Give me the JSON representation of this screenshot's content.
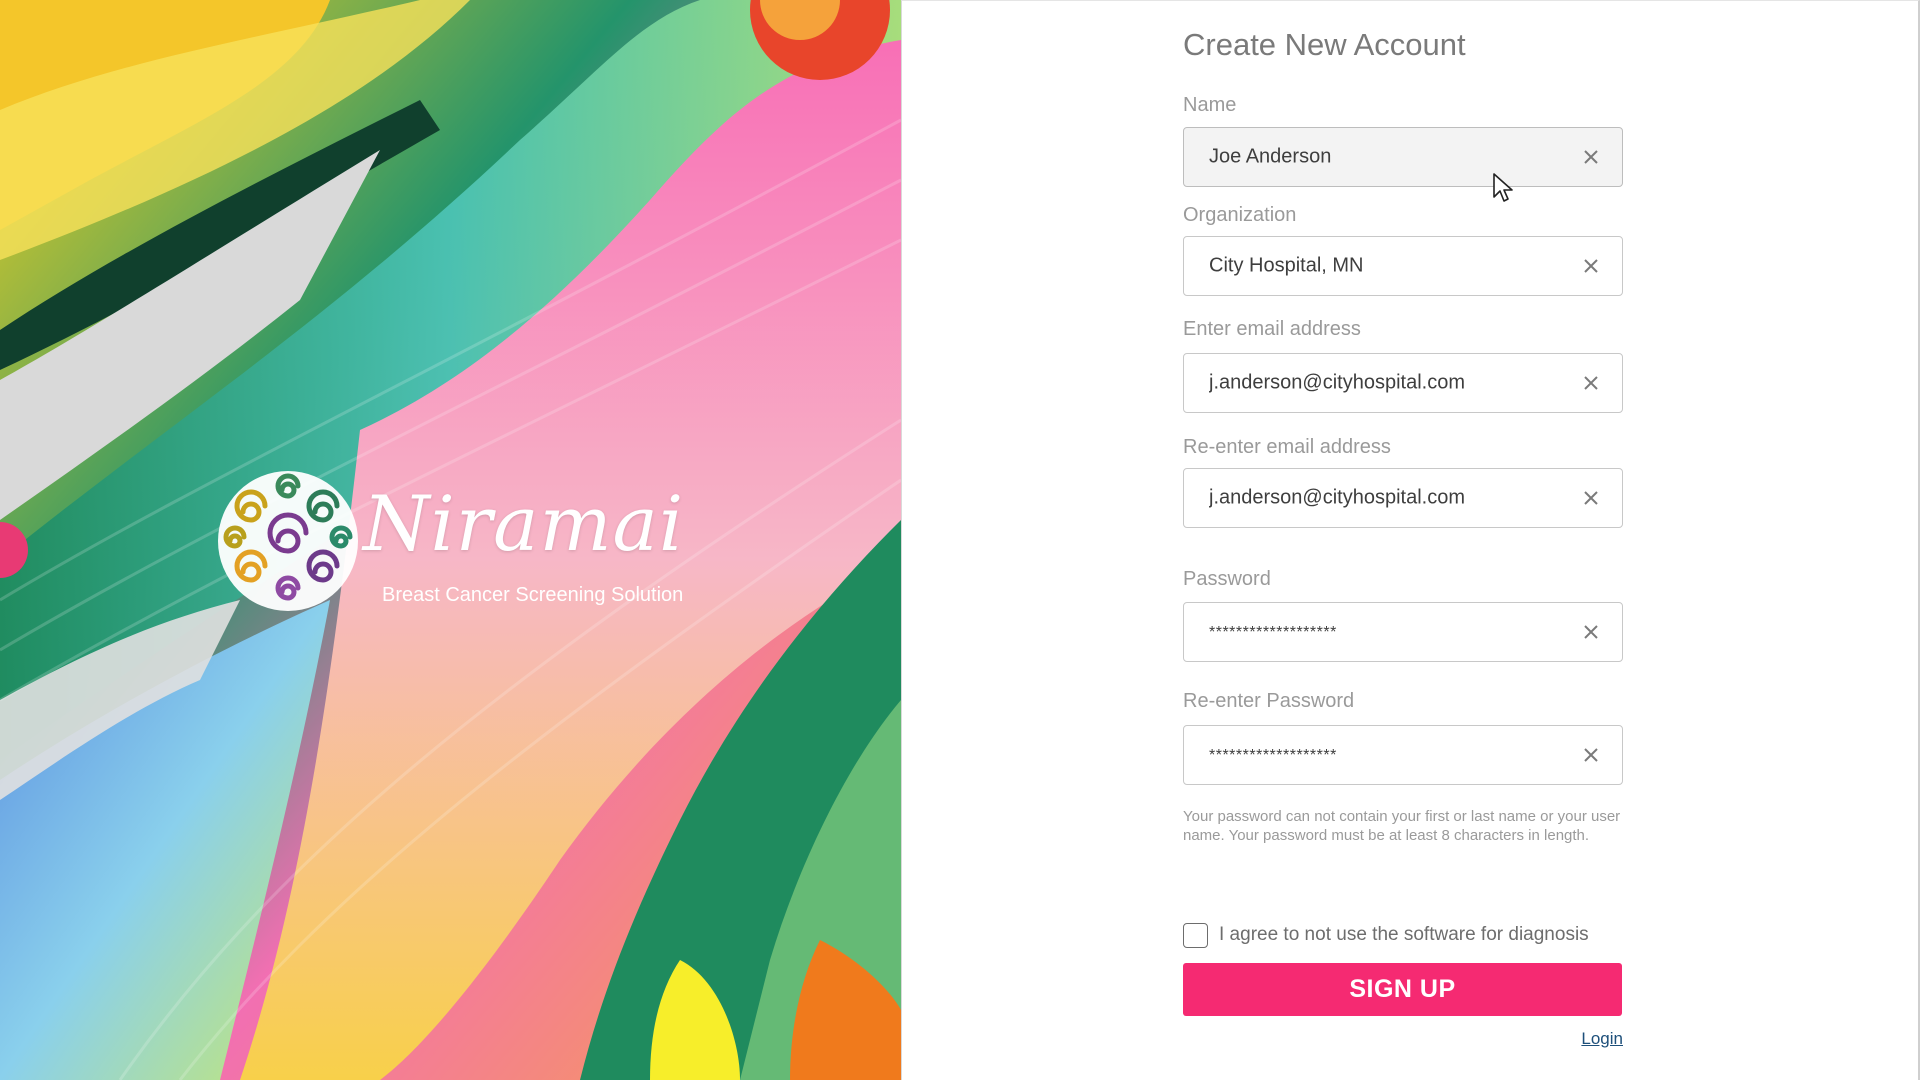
{
  "brand": {
    "name": "Niramai",
    "tagline": "Breast Cancer Screening Solution"
  },
  "form": {
    "title": "Create New Account",
    "fields": [
      {
        "label": "Name",
        "value": "Joe Anderson",
        "masked": false,
        "active": true
      },
      {
        "label": "Organization",
        "value": "City Hospital, MN",
        "masked": false,
        "active": false
      },
      {
        "label": "Enter email address",
        "value": "j.anderson@cityhospital.com",
        "masked": false,
        "active": false
      },
      {
        "label": "Re-enter email address",
        "value": "j.anderson@cityhospital.com",
        "masked": false,
        "active": false
      },
      {
        "label": "Password",
        "value": "*******************",
        "masked": true,
        "active": false
      },
      {
        "label": "Re-enter Password",
        "value": "*******************",
        "masked": true,
        "active": false
      }
    ],
    "password_hint": "Your password can not contain your first or last name or your user name. Your password must be at least 8 characters in length.",
    "agree_label": "I agree to not use the software for diagnosis",
    "agree_checked": false,
    "submit_label": "SIGN UP",
    "login_label": "Login"
  },
  "colors": {
    "accent": "#f52a72",
    "link": "#1d4f7a",
    "label": "#9a9a9a",
    "input_text": "#3e3e3e"
  },
  "icons": {
    "clear": "close-icon",
    "brand": "swirl-emblem-icon",
    "pointer": "mouse-cursor-icon"
  }
}
